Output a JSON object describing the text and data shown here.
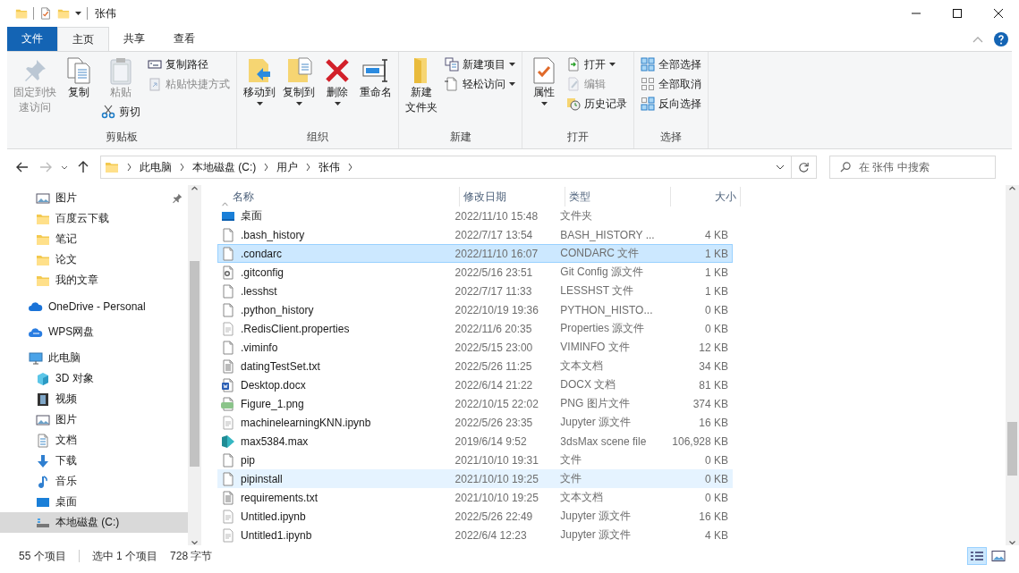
{
  "window": {
    "title": "张伟"
  },
  "tabs": [
    {
      "label": "文件",
      "kind": "menu",
      "selected": false
    },
    {
      "label": "主页",
      "kind": "tab",
      "selected": true
    },
    {
      "label": "共享",
      "kind": "tab",
      "selected": false
    },
    {
      "label": "查看",
      "kind": "tab",
      "selected": false
    }
  ],
  "ribbon": {
    "groups": [
      {
        "label": "剪贴板",
        "columns": [
          [
            {
              "kind": "large",
              "label": [
                "固定到快",
                "速访问"
              ],
              "disabled": true,
              "dropdown": false
            }
          ],
          [
            {
              "kind": "large",
              "label": "复制",
              "disabled": false,
              "dropdown": false
            }
          ],
          [
            {
              "kind": "large",
              "label": "粘贴",
              "disabled": true,
              "dropdown": false
            },
            {
              "kind": "small",
              "label": "剪切",
              "disabled": false,
              "dropdown": false
            }
          ],
          [
            {
              "kind": "small",
              "label": "复制路径",
              "disabled": false,
              "dropdown": false
            },
            {
              "kind": "small",
              "label": "粘贴快捷方式",
              "disabled": true,
              "dropdown": false
            }
          ]
        ]
      },
      {
        "label": "组织",
        "columns": [
          [
            {
              "kind": "large",
              "label": "移动到",
              "disabled": false,
              "dropdown": true
            }
          ],
          [
            {
              "kind": "large",
              "label": "复制到",
              "disabled": false,
              "dropdown": true
            }
          ],
          [
            {
              "kind": "large",
              "label": "删除",
              "disabled": false,
              "dropdown": true
            }
          ],
          [
            {
              "kind": "large",
              "label": "重命名",
              "disabled": false,
              "dropdown": false
            }
          ]
        ]
      },
      {
        "label": "新建",
        "columns": [
          [
            {
              "kind": "large",
              "label": [
                "新建",
                "文件夹"
              ],
              "disabled": false,
              "dropdown": false
            }
          ],
          [
            {
              "kind": "small",
              "label": "新建项目",
              "disabled": false,
              "dropdown": true
            },
            {
              "kind": "small",
              "label": "轻松访问",
              "disabled": false,
              "dropdown": true
            }
          ]
        ]
      },
      {
        "label": "打开",
        "columns": [
          [
            {
              "kind": "large",
              "label": "属性",
              "disabled": false,
              "dropdown": true
            }
          ],
          [
            {
              "kind": "small",
              "label": "打开",
              "disabled": false,
              "dropdown": true
            },
            {
              "kind": "small",
              "label": "编辑",
              "disabled": true,
              "dropdown": false
            },
            {
              "kind": "small",
              "label": "历史记录",
              "disabled": false,
              "dropdown": false
            }
          ]
        ]
      },
      {
        "label": "选择",
        "columns": [
          [
            {
              "kind": "small",
              "label": "全部选择",
              "disabled": false,
              "dropdown": false
            },
            {
              "kind": "small",
              "label": "全部取消",
              "disabled": false,
              "dropdown": false
            },
            {
              "kind": "small",
              "label": "反向选择",
              "disabled": false,
              "dropdown": false
            }
          ]
        ]
      }
    ]
  },
  "address": {
    "crumbs": [
      "此电脑",
      "本地磁盘 (C:)",
      "用户",
      "张伟"
    ]
  },
  "search": {
    "placeholder": "在 张伟 中搜索"
  },
  "sidebar": {
    "pinned": [
      {
        "label": "图片",
        "kind": "pictures",
        "pinned": true,
        "selected": false
      },
      {
        "label": "百度云下载",
        "kind": "folder",
        "pinned": false,
        "selected": false
      },
      {
        "label": "笔记",
        "kind": "folder",
        "pinned": false,
        "selected": false
      },
      {
        "label": "论文",
        "kind": "folder",
        "pinned": false,
        "selected": false
      },
      {
        "label": "我的文章",
        "kind": "folder",
        "pinned": false,
        "selected": false
      }
    ],
    "locations": [
      {
        "label": "OneDrive - Personal",
        "kind": "onedrive",
        "selected": false
      },
      {
        "label": "WPS网盘",
        "kind": "wps",
        "selected": false
      },
      {
        "label": "此电脑",
        "kind": "pc",
        "selected": false,
        "children": [
          {
            "label": "3D 对象",
            "kind": "objects",
            "selected": false
          },
          {
            "label": "视频",
            "kind": "videos",
            "selected": false
          },
          {
            "label": "图片",
            "kind": "pictures",
            "selected": false
          },
          {
            "label": "文档",
            "kind": "documents",
            "selected": false
          },
          {
            "label": "下载",
            "kind": "downloads",
            "selected": false
          },
          {
            "label": "音乐",
            "kind": "music",
            "selected": false
          },
          {
            "label": "桌面",
            "kind": "desktop",
            "selected": false
          },
          {
            "label": "本地磁盘 (C:)",
            "kind": "drive",
            "selected": true
          }
        ]
      }
    ]
  },
  "table": {
    "columns": [
      "名称",
      "修改日期",
      "类型",
      "大小"
    ],
    "rows": [
      {
        "kind": "desktop",
        "name": "桌面",
        "date": "2022/11/10 15:48",
        "type": "文件夹",
        "size": "",
        "selected": false,
        "hovered": false
      },
      {
        "kind": "file",
        "name": ".bash_history",
        "date": "2022/7/17 13:54",
        "type": "BASH_HISTORY ...",
        "size": "4 KB",
        "selected": false,
        "hovered": false
      },
      {
        "kind": "file",
        "name": ".condarc",
        "date": "2022/11/10 16:07",
        "type": "CONDARC 文件",
        "size": "1 KB",
        "selected": true,
        "hovered": false
      },
      {
        "kind": "config",
        "name": ".gitconfig",
        "date": "2022/5/16 23:51",
        "type": "Git Config 源文件",
        "size": "1 KB",
        "selected": false,
        "hovered": false
      },
      {
        "kind": "file",
        "name": ".lesshst",
        "date": "2022/7/17 11:33",
        "type": "LESSHST 文件",
        "size": "1 KB",
        "selected": false,
        "hovered": false
      },
      {
        "kind": "file",
        "name": ".python_history",
        "date": "2022/10/19 19:36",
        "type": "PYTHON_HISTO...",
        "size": "0 KB",
        "selected": false,
        "hovered": false
      },
      {
        "kind": "notebook",
        "name": ".RedisClient.properties",
        "date": "2022/11/6 20:35",
        "type": "Properties 源文件",
        "size": "0 KB",
        "selected": false,
        "hovered": false
      },
      {
        "kind": "file",
        "name": ".viminfo",
        "date": "2022/5/15 23:00",
        "type": "VIMINFO 文件",
        "size": "12 KB",
        "selected": false,
        "hovered": false
      },
      {
        "kind": "text",
        "name": "datingTestSet.txt",
        "date": "2022/5/26 11:25",
        "type": "文本文档",
        "size": "34 KB",
        "selected": false,
        "hovered": false
      },
      {
        "kind": "word",
        "name": "Desktop.docx",
        "date": "2022/6/14 21:22",
        "type": "DOCX 文档",
        "size": "81 KB",
        "selected": false,
        "hovered": false
      },
      {
        "kind": "image",
        "name": "Figure_1.png",
        "date": "2022/10/15 22:02",
        "type": "PNG 图片文件",
        "size": "374 KB",
        "selected": false,
        "hovered": false
      },
      {
        "kind": "notebook",
        "name": "machinelearningKNN.ipynb",
        "date": "2022/5/26 23:35",
        "type": "Jupyter 源文件",
        "size": "16 KB",
        "selected": false,
        "hovered": false
      },
      {
        "kind": "max",
        "name": "max5384.max",
        "date": "2019/6/14 9:52",
        "type": "3dsMax scene file",
        "size": "106,928 KB",
        "selected": false,
        "hovered": false
      },
      {
        "kind": "file",
        "name": "pip",
        "date": "2021/10/10 19:31",
        "type": "文件",
        "size": "0 KB",
        "selected": false,
        "hovered": false
      },
      {
        "kind": "file",
        "name": "pipinstall",
        "date": "2021/10/10 19:25",
        "type": "文件",
        "size": "0 KB",
        "selected": false,
        "hovered": true
      },
      {
        "kind": "text",
        "name": "requirements.txt",
        "date": "2021/10/10 19:25",
        "type": "文本文档",
        "size": "0 KB",
        "selected": false,
        "hovered": false
      },
      {
        "kind": "notebook",
        "name": "Untitled.ipynb",
        "date": "2022/5/26 22:49",
        "type": "Jupyter 源文件",
        "size": "16 KB",
        "selected": false,
        "hovered": false
      },
      {
        "kind": "notebook",
        "name": "Untitled1.ipynb",
        "date": "2022/6/4 12:23",
        "type": "Jupyter 源文件",
        "size": "4 KB",
        "selected": false,
        "hovered": false
      }
    ]
  },
  "status_bar": {
    "count": "55 个项目",
    "selection": "选中 1 个项目",
    "size": "728 字节"
  },
  "views": [
    {
      "kind": "details",
      "selected": true
    },
    {
      "kind": "large-icons",
      "selected": false
    }
  ]
}
